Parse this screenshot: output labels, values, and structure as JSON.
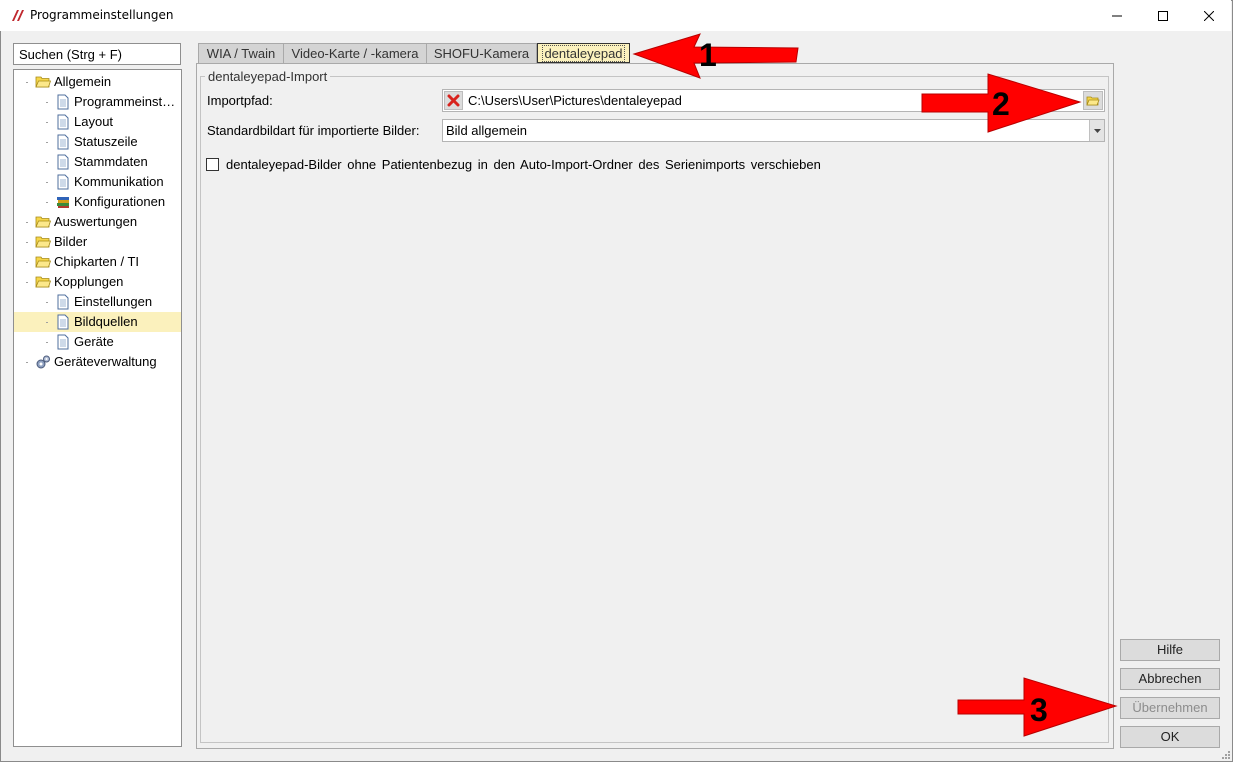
{
  "window": {
    "title": "Programmeinstellungen",
    "controls": {
      "minimize": "minimize",
      "maximize": "maximize",
      "close": "close"
    }
  },
  "search": {
    "placeholder": "Suchen (Strg + F)"
  },
  "tree": {
    "items": [
      {
        "label": "Allgemein",
        "icon": "folder-icon",
        "level": 0
      },
      {
        "label": "Programmeinst…",
        "icon": "page-icon",
        "level": 1
      },
      {
        "label": "Layout",
        "icon": "page-icon",
        "level": 1
      },
      {
        "label": "Statuszeile",
        "icon": "page-icon",
        "level": 1
      },
      {
        "label": "Stammdaten",
        "icon": "page-icon",
        "level": 1
      },
      {
        "label": "Kommunikation",
        "icon": "page-icon",
        "level": 1
      },
      {
        "label": "Konfigurationen",
        "icon": "books-icon",
        "level": 1
      },
      {
        "label": "Auswertungen",
        "icon": "folder-icon",
        "level": 0
      },
      {
        "label": "Bilder",
        "icon": "folder-icon",
        "level": 0
      },
      {
        "label": "Chipkarten / TI",
        "icon": "folder-icon",
        "level": 0
      },
      {
        "label": "Kopplungen",
        "icon": "folder-icon",
        "level": 0
      },
      {
        "label": "Einstellungen",
        "icon": "page-icon",
        "level": 1
      },
      {
        "label": "Bildquellen",
        "icon": "page-icon",
        "level": 1,
        "selected": true
      },
      {
        "label": "Geräte",
        "icon": "page-icon",
        "level": 1
      },
      {
        "label": "Geräteverwaltung",
        "icon": "gears-icon",
        "level": 0
      }
    ]
  },
  "tabs": [
    {
      "label": "WIA / Twain"
    },
    {
      "label": "Video-Karte / -kamera"
    },
    {
      "label": "SHOFU-Kamera"
    },
    {
      "label": "dentaleyepad",
      "active": true
    }
  ],
  "group": {
    "title": "dentaleyepad-Import",
    "import_label": "Importpfad:",
    "import_value": "C:\\Users\\User\\Pictures\\dentaleyepad",
    "bildart_label": "Standardbildart für importierte Bilder:",
    "bildart_value": "Bild allgemein",
    "checkbox_label": "dentaleyepad-Bilder ohne Patientenbezug in den Auto-Import-Ordner des Serienimports verschieben",
    "checkbox_checked": false
  },
  "buttons": {
    "hilfe": "Hilfe",
    "abbrechen": "Abbrechen",
    "uebernehmen": "Übernehmen",
    "ok": "OK"
  },
  "annotations": [
    "1",
    "2",
    "3"
  ],
  "colors": {
    "selection": "#fbf1bd",
    "annotation_arrow": "#ff0000",
    "folder": "#f5d64a"
  }
}
